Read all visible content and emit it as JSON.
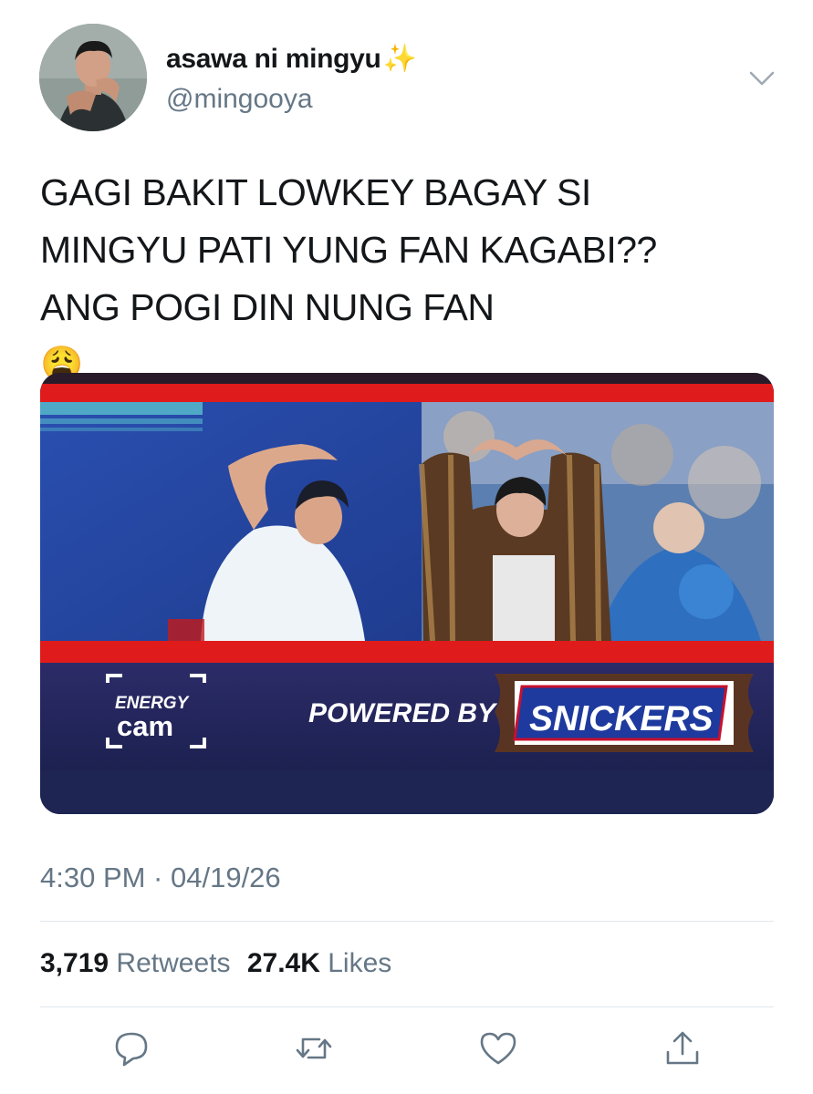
{
  "author": {
    "display_name": "asawa ni mingyu",
    "name_emoji": "✨",
    "handle": "@mingooya"
  },
  "tweet": {
    "lines": [
      "GAGI BAKIT LOWKEY BAGAY SI",
      "MINGYU PATI YUNG FAN KAGABI??",
      "ANG POGI DIN NUNG FAN"
    ],
    "line_end_emoji": "😩"
  },
  "media": {
    "energy_cam_top": "ENERGY",
    "energy_cam_bottom": "cam",
    "powered_by": "POWERED BY",
    "brand": "SNICKERS"
  },
  "meta": {
    "timestamp": "4:30 PM · 04/19/26"
  },
  "stats": {
    "retweets_count": "3,719",
    "retweets_label": "Retweets",
    "likes_count": "27.4K",
    "likes_label": "Likes"
  },
  "icons": {
    "reply": "reply-icon",
    "retweet": "retweet-icon",
    "like": "heart-icon",
    "share": "share-icon",
    "menu": "chevron-down-icon"
  },
  "colors": {
    "text": "#14171a",
    "secondary": "#657786",
    "divider": "#e1e8ed",
    "snickers_blue": "#1e3a9e",
    "broadcast_red": "#e01b1b"
  }
}
